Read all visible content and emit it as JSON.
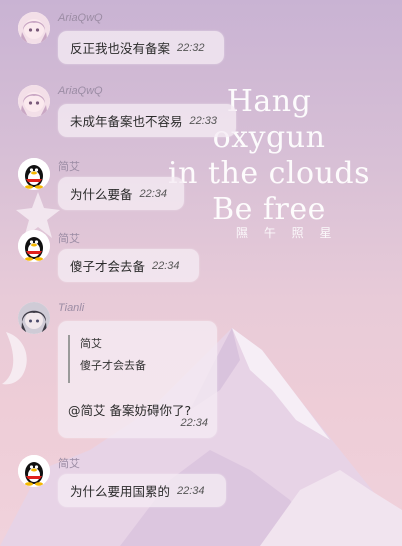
{
  "background": {
    "title_lines": [
      "Hang oxygun",
      "in the clouds",
      "Be free"
    ],
    "subtitle": "隰 午 照 星"
  },
  "messages": [
    {
      "sender": "AriaQwQ",
      "text": "反正我也没有备案",
      "time": "22:32",
      "avatar": "anime-girl-pink"
    },
    {
      "sender": "AriaQwQ",
      "text": "未成年备案也不容易",
      "time": "22:33",
      "avatar": "anime-girl-pink"
    },
    {
      "sender": "简艾",
      "text": "为什么要备",
      "time": "22:34",
      "avatar": "qq-penguin"
    },
    {
      "sender": "简艾",
      "text": "傻子才会去备",
      "time": "22:34",
      "avatar": "qq-penguin"
    },
    {
      "sender": "Tianli",
      "quote_name": "简艾",
      "quote_text": "傻子才会去备",
      "text": "@简艾 备案妨碍你了?",
      "time": "22:34",
      "avatar": "anime-girl-dark"
    },
    {
      "sender": "简艾",
      "text": "为什么要用国累的",
      "time": "22:34",
      "avatar": "qq-penguin"
    }
  ],
  "colors": {
    "bubble": "#f5ecf4",
    "sender": "#9b8ca4",
    "text": "#2b2b2b"
  }
}
